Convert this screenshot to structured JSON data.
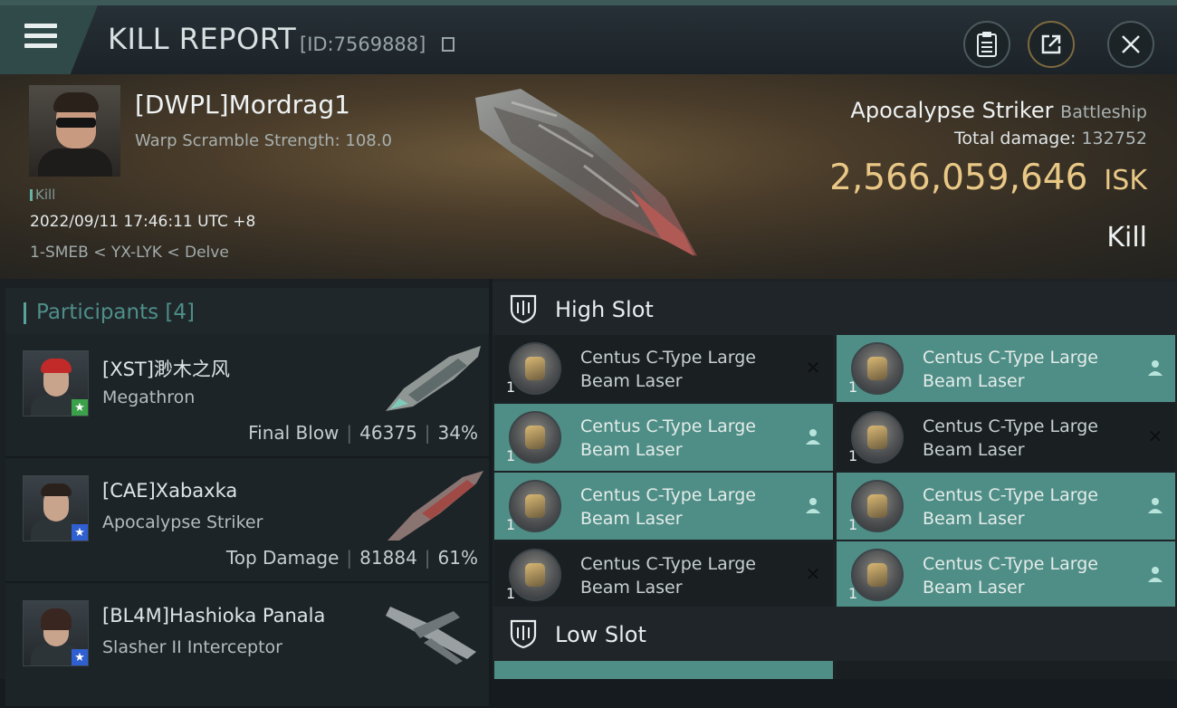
{
  "header": {
    "title": "KILL REPORT",
    "report_id": "[ID:7569888]"
  },
  "victim": {
    "name": "[DWPL]Mordrag1",
    "warp_scramble": "Warp Scramble Strength: 108.0",
    "tag": "Kill",
    "timestamp": "2022/09/11 17:46:11 UTC +8",
    "location": "1-SMEB < YX-LYK < Delve",
    "ship_name": "Apocalypse Striker",
    "ship_class": "Battleship",
    "total_damage_label": "Total damage:",
    "total_damage_value": "132752",
    "isk_value": "2,566,059,646",
    "isk_unit": "ISK",
    "result": "Kill"
  },
  "participants": {
    "header": "Participants [4]",
    "items": [
      {
        "name": "[XST]渺木之风",
        "ship": "Megathron",
        "role": "Final Blow",
        "damage": "46375",
        "percent": "34%",
        "badge_color": "#3aa14a"
      },
      {
        "name": "[CAE]Xabaxka",
        "ship": "Apocalypse Striker",
        "role": "Top Damage",
        "damage": "81884",
        "percent": "61%",
        "badge_color": "#2f5fd0"
      },
      {
        "name": "[BL4M]Hashioka Panala",
        "ship": "Slasher II Interceptor",
        "role": "",
        "damage": "",
        "percent": "",
        "badge_color": "#2f5fd0"
      }
    ]
  },
  "fitting": {
    "high_slot_label": "High Slot",
    "low_slot_label": "Low Slot",
    "high_modules": [
      {
        "name": "Centus C-Type Large Beam Laser",
        "qty": "1",
        "state": "destroyed"
      },
      {
        "name": "Centus C-Type Large Beam Laser",
        "qty": "1",
        "state": "dropped"
      },
      {
        "name": "Centus C-Type Large Beam Laser",
        "qty": "1",
        "state": "dropped"
      },
      {
        "name": "Centus C-Type Large Beam Laser",
        "qty": "1",
        "state": "destroyed"
      },
      {
        "name": "Centus C-Type Large Beam Laser",
        "qty": "1",
        "state": "dropped"
      },
      {
        "name": "Centus C-Type Large Beam Laser",
        "qty": "1",
        "state": "dropped"
      },
      {
        "name": "Centus C-Type Large Beam Laser",
        "qty": "1",
        "state": "destroyed"
      },
      {
        "name": "Centus C-Type Large Beam Laser",
        "qty": "1",
        "state": "dropped"
      }
    ]
  },
  "icons": {
    "menu": "hamburger-menu-icon",
    "clipboard": "clipboard-icon",
    "share": "share-icon",
    "close": "close-icon",
    "copy": "copy-icon",
    "shield": "shield-icon",
    "person": "person-icon",
    "x": "x-icon"
  },
  "colors": {
    "accent": "#4f8e86",
    "isk_gold": "#e9c886",
    "participants_header": "#4f8e88"
  }
}
